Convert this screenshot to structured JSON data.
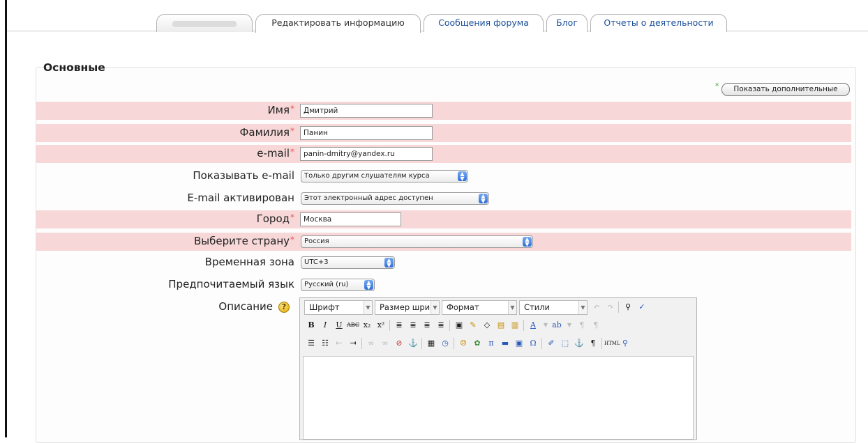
{
  "tabs": [
    {
      "label": "",
      "state": "blank"
    },
    {
      "label": "Редактировать информацию",
      "state": "active"
    },
    {
      "label": "Сообщения форума",
      "state": "normal"
    },
    {
      "label": "Блог",
      "state": "normal"
    },
    {
      "label": "Отчеты о деятельности",
      "state": "normal"
    }
  ],
  "section": {
    "legend": "Основные",
    "advanced_button": "Показать дополнительные",
    "required_marker": "*"
  },
  "fields": {
    "first_name": {
      "label": "Имя",
      "value": "Дмитрий",
      "required": true
    },
    "last_name": {
      "label": "Фамилия",
      "value": "Панин",
      "required": true
    },
    "email": {
      "label": "e-mail",
      "value": "panin-dmitry@yandex.ru",
      "required": true
    },
    "show_email": {
      "label": "Показывать e-mail",
      "selected": "Только другим слушателям курса"
    },
    "email_active": {
      "label": "E-mail активирован",
      "selected": "Этот электронный адрес доступен"
    },
    "city": {
      "label": "Город",
      "value": "Москва",
      "required": true
    },
    "country": {
      "label": "Выберите страну",
      "selected": "Россия",
      "required": true
    },
    "timezone": {
      "label": "Временная зона",
      "selected": "UTC+3"
    },
    "language": {
      "label": "Предпочитаемый язык",
      "selected": "Русский (ru)"
    },
    "description": {
      "label": "Описание"
    }
  },
  "editor": {
    "font_combo": "Шрифт",
    "size_combo": "Размер шри",
    "format_combo": "Формат",
    "styles_combo": "Стили"
  },
  "colors": {
    "required_row_bg": "#f7d7d7",
    "link_blue": "#1b4f9c",
    "required_star": "#e35a5a"
  }
}
